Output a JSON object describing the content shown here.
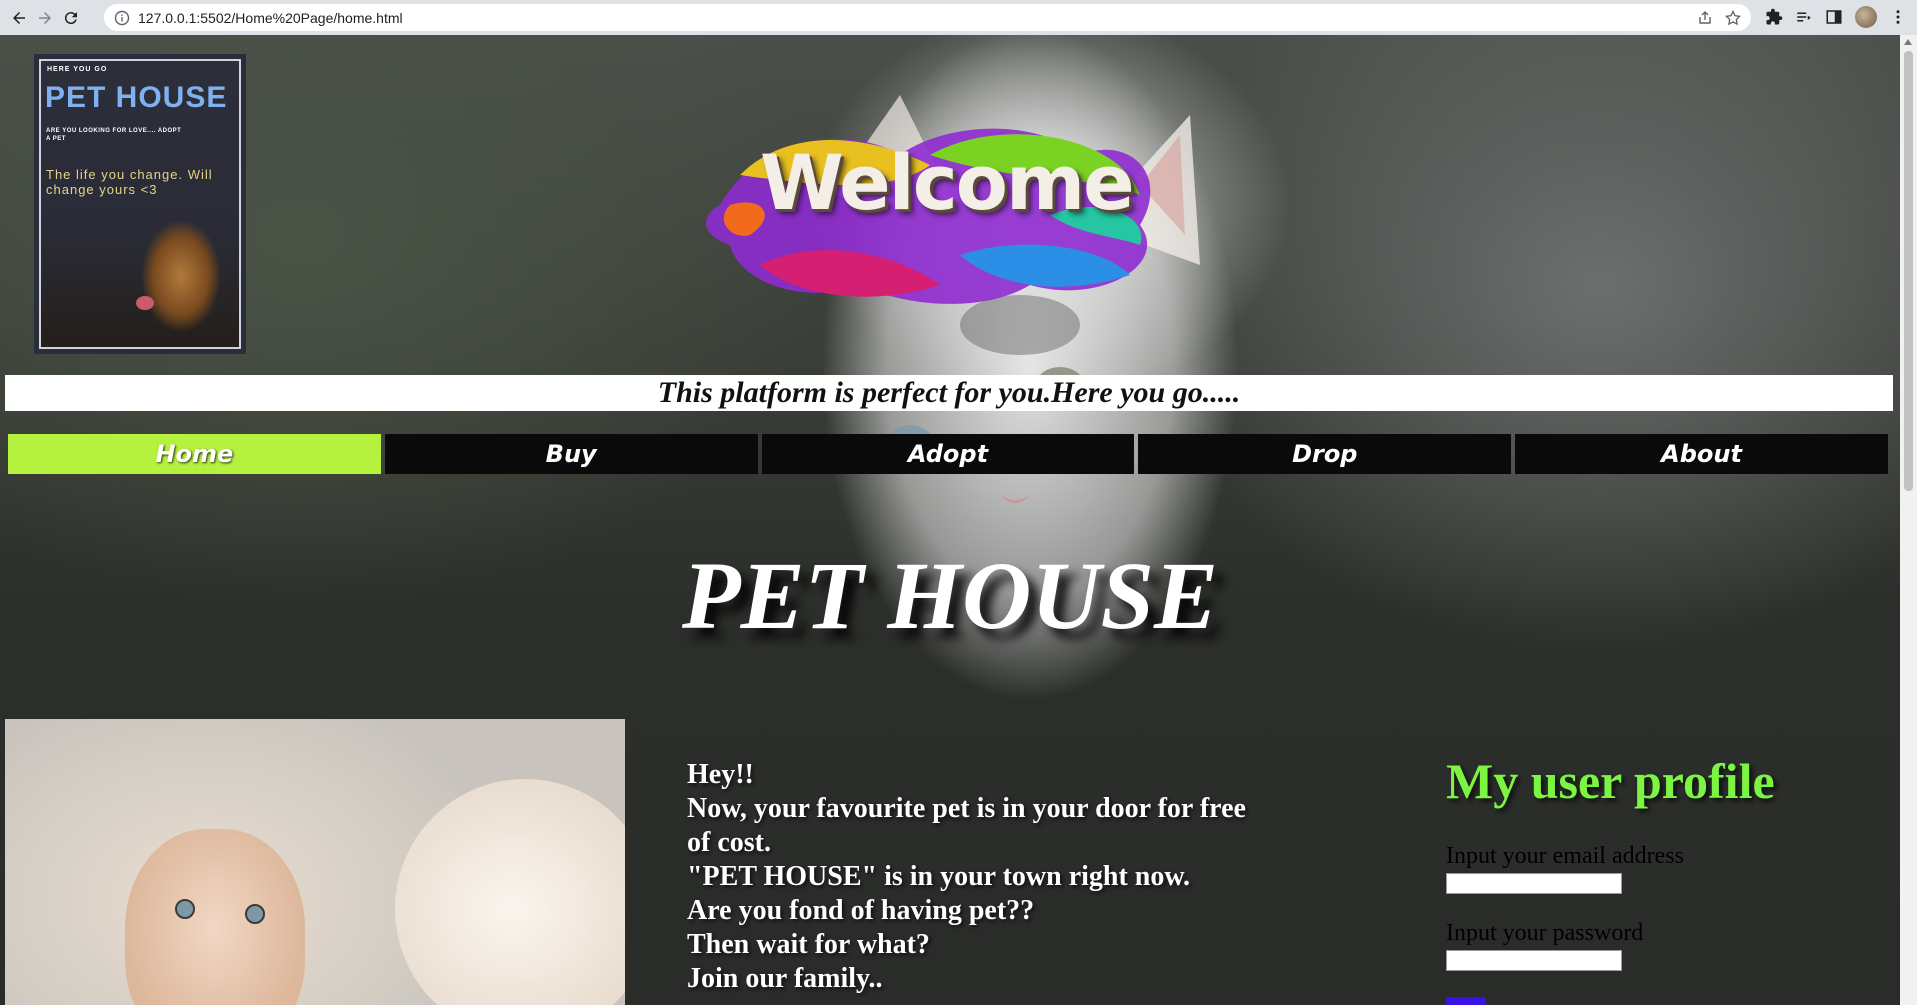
{
  "browser": {
    "url": "127.0.0.1:5502/Home%20Page/home.html"
  },
  "poster": {
    "small_top": "HERE YOU GO",
    "title": "PET HOUSE",
    "tagline": "ARE YOU LOOKING FOR LOVE.... ADOPT A PET",
    "quote": "The life you change. Will change yours <3"
  },
  "welcome": {
    "text": "Welcome"
  },
  "banner": {
    "text": "This platform is perfect for you.Here you go....."
  },
  "nav": {
    "items": [
      "Home",
      "Buy",
      "Adopt",
      "Drop",
      "About"
    ],
    "active": "Home",
    "active_color": "#b5f23d"
  },
  "main": {
    "title": "PET HOUSE",
    "intro_lines": [
      "Hey!!",
      "Now, your favourite pet is in your door for free of cost.",
      "\"PET HOUSE\" is in your town right now.",
      "Are you fond of having pet??",
      "Then wait for what?",
      "Join our family.."
    ]
  },
  "profile": {
    "title": "My user profile",
    "title_color": "#7cf542",
    "email_label": "Input your email address",
    "password_label": "Input your password"
  }
}
